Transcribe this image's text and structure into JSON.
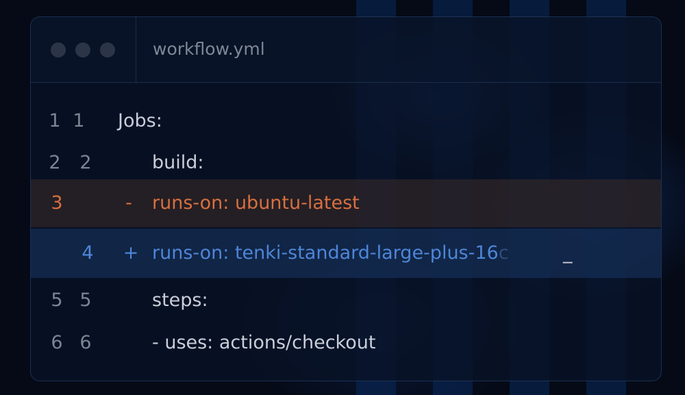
{
  "window": {
    "filename": "workflow.yml",
    "controls": [
      "close",
      "minimize",
      "maximize"
    ],
    "colors": {
      "removed": "#d8703f",
      "added": "#4d86d8",
      "text": "#c9ced8",
      "line_number": "#7d8493"
    }
  },
  "diff": {
    "lines": [
      {
        "old": "1",
        "new": "1",
        "sign": "",
        "text": "Jobs:",
        "type": "context"
      },
      {
        "old": "2",
        "new": "2",
        "sign": "",
        "text": "build:",
        "type": "context"
      },
      {
        "old": "3",
        "new": "",
        "sign": "-",
        "text": "runs-on: ubuntu-latest",
        "type": "removed"
      },
      {
        "old": "",
        "new": "4",
        "sign": "+",
        "text": "runs-on: tenki-standard-large-plus-16",
        "tail": "c",
        "cursor": "_",
        "type": "added"
      },
      {
        "old": "5",
        "new": "5",
        "sign": "",
        "text": "steps:",
        "type": "context"
      },
      {
        "old": "6",
        "new": "6",
        "sign": "",
        "text": "- uses: actions/checkout",
        "type": "context"
      }
    ]
  }
}
